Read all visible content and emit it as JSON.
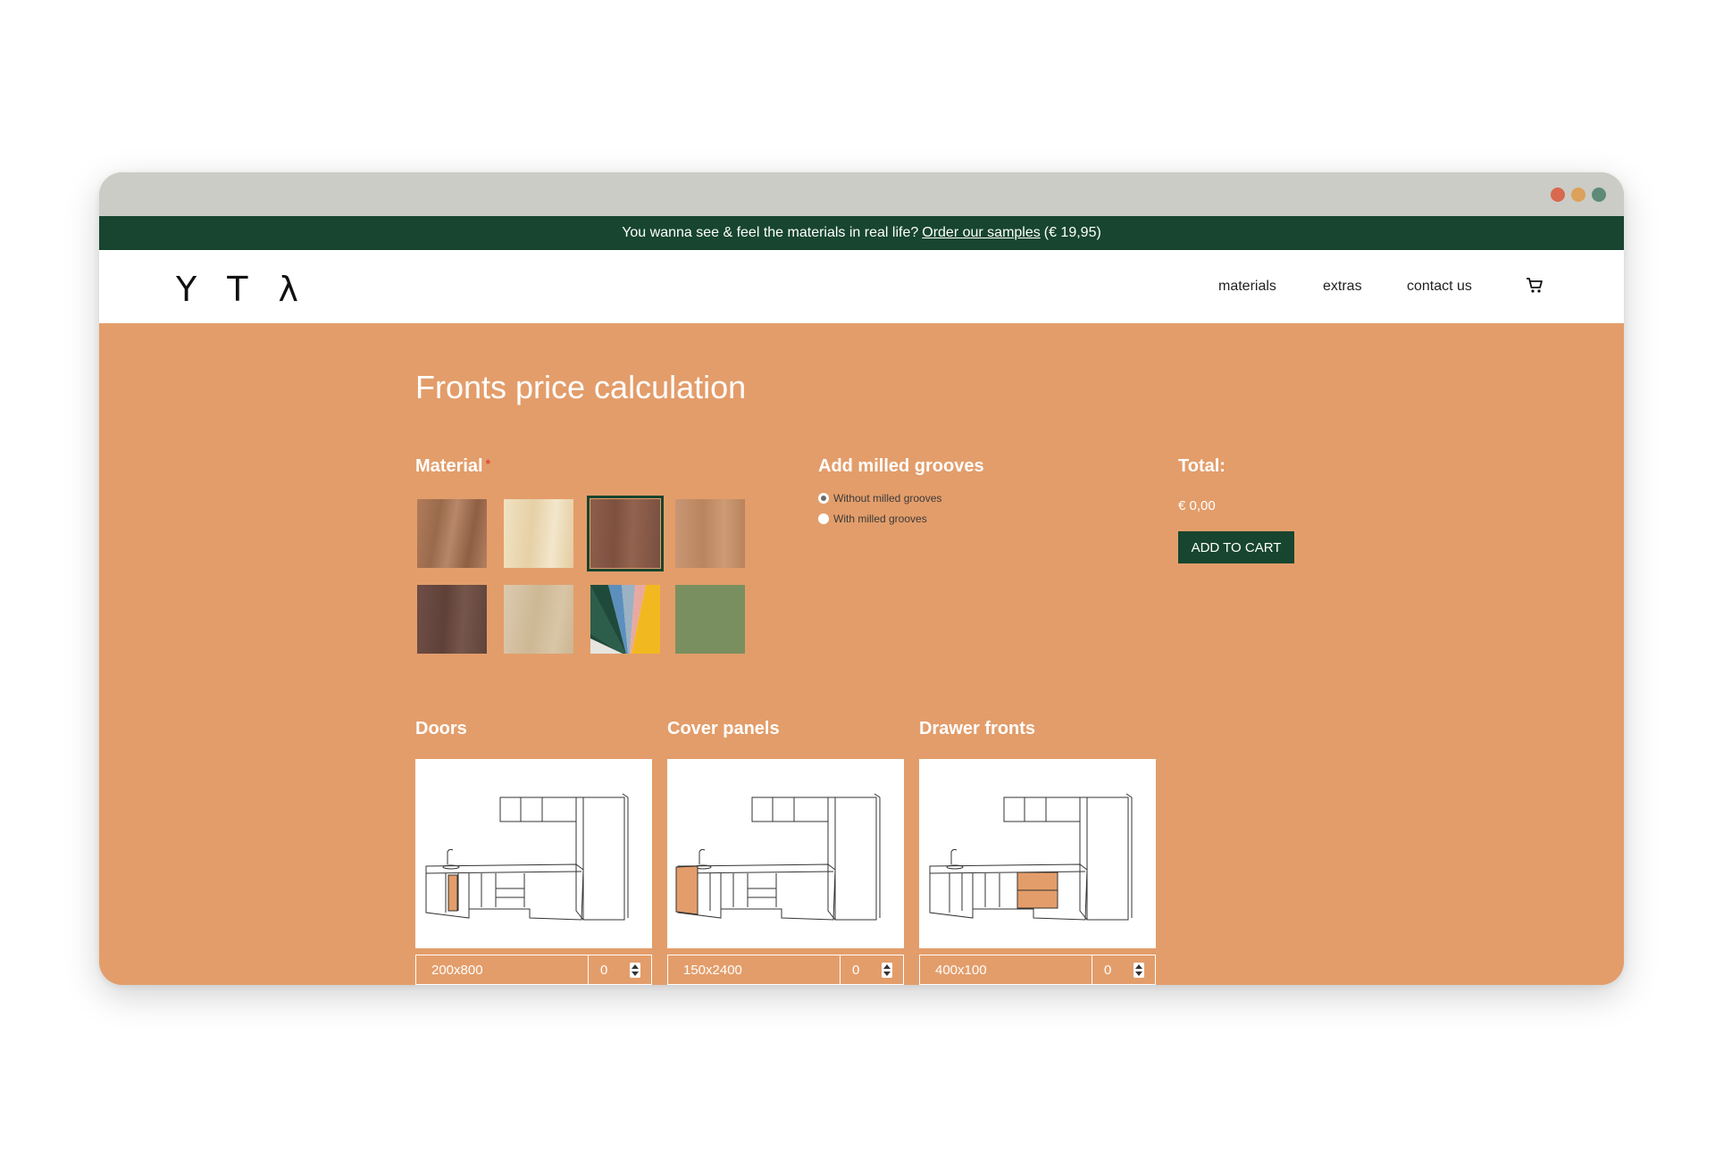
{
  "banner": {
    "text_before": "You wanna see & feel the materials in real life?",
    "link_text": "Order our samples",
    "text_after": "(€ 19,95)"
  },
  "logo": {
    "letters": [
      "Y",
      "T",
      "λ"
    ]
  },
  "nav": {
    "items": [
      {
        "label": "materials"
      },
      {
        "label": "extras"
      },
      {
        "label": "contact us"
      }
    ]
  },
  "page": {
    "title": "Fronts price calculation"
  },
  "material": {
    "heading": "Material",
    "required_mark": "*",
    "selected_index": 2,
    "swatches": [
      {
        "name": "oak-swatch",
        "color": "#a9765a"
      },
      {
        "name": "birch-swatch",
        "color": "#ecd9b4"
      },
      {
        "name": "walnut-veneer-swatch",
        "color": "#8a5a48"
      },
      {
        "name": "light-oak-swatch",
        "color": "#c38f69"
      },
      {
        "name": "dark-walnut-swatch",
        "color": "#6c4b43"
      },
      {
        "name": "plywood-swatch",
        "color": "#d6c3a3"
      },
      {
        "name": "color-fan-swatch",
        "color": "#6f93b4"
      },
      {
        "name": "green-linoleum-swatch",
        "color": "#7a8f5f"
      }
    ]
  },
  "grooves": {
    "heading": "Add milled grooves",
    "options": [
      {
        "label": "Without milled grooves",
        "checked": true
      },
      {
        "label": "With milled grooves",
        "checked": false
      }
    ]
  },
  "total": {
    "heading": "Total:",
    "price": "€ 0,00",
    "add_to_cart": "ADD TO CART"
  },
  "products": [
    {
      "heading": "Doors",
      "size": "200x800",
      "qty": "0"
    },
    {
      "heading": "Cover panels",
      "size": "150x2400",
      "qty": "0"
    },
    {
      "heading": "Drawer fronts",
      "size": "400x100",
      "qty": "0"
    }
  ],
  "colors": {
    "accent_dark_green": "#17452f",
    "page_orange": "#e39d6a",
    "highlight_orange": "#e39d6a",
    "dot_red": "#d8694e",
    "dot_yellow": "#dca15a",
    "dot_green": "#5f8a78"
  }
}
